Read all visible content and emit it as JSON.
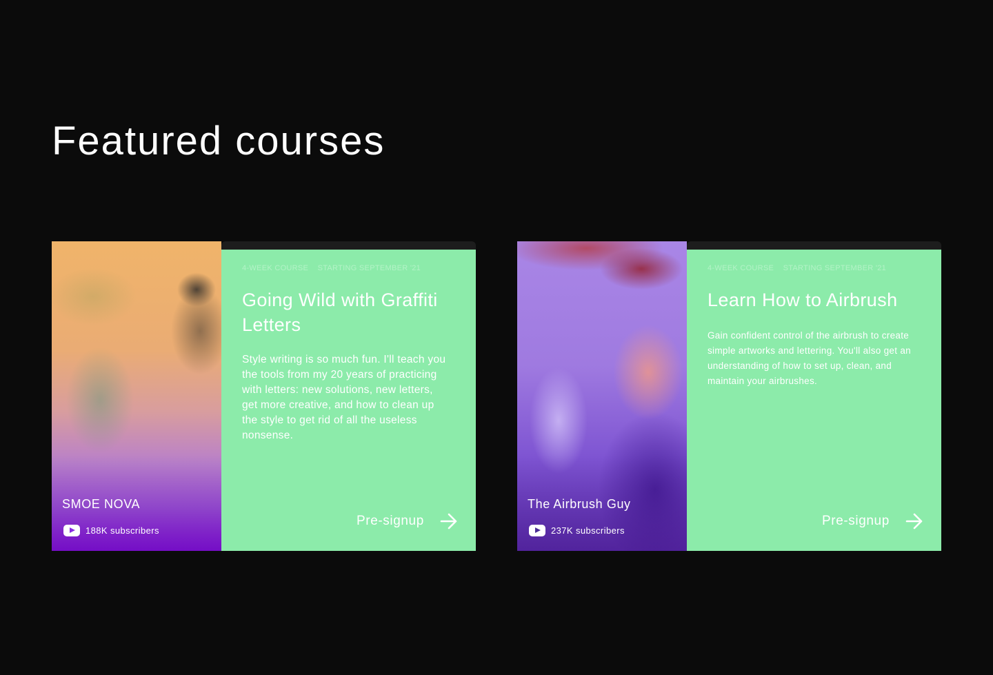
{
  "page": {
    "title": "Featured courses",
    "background": "#0b0b0b"
  },
  "theme": {
    "card_green": "#8cebaa",
    "text": "#ffffff"
  },
  "courses": [
    {
      "creator": {
        "name": "SMOE NOVA",
        "subscribers": "188K subscribers",
        "platform_icon": "youtube-icon"
      },
      "meta": {
        "duration": "4-WEEK COURSE",
        "start": "STARTING SEPTEMBER '21"
      },
      "title": "Going Wild with Graffiti Letters",
      "description": "Style writing is so much fun. I'll teach you the tools from my 20 years of practicing with letters: new solutions, new letters, get more creative, and how to clean up the style to get rid of all the useless nonsense.",
      "cta_label": "Pre-signup",
      "cta_icon": "arrow-right-icon"
    },
    {
      "creator": {
        "name": "The Airbrush Guy",
        "subscribers": "237K subscribers",
        "platform_icon": "youtube-icon"
      },
      "meta": {
        "duration": "4-WEEK COURSE",
        "start": "STARTING SEPTEMBER '21"
      },
      "title": "Learn How to Airbrush",
      "description": "Gain confident control of the airbrush to create simple artworks and lettering. You'll also get an understanding of how to set up, clean, and maintain your airbrushes.",
      "cta_label": "Pre-signup",
      "cta_icon": "arrow-right-icon"
    }
  ]
}
